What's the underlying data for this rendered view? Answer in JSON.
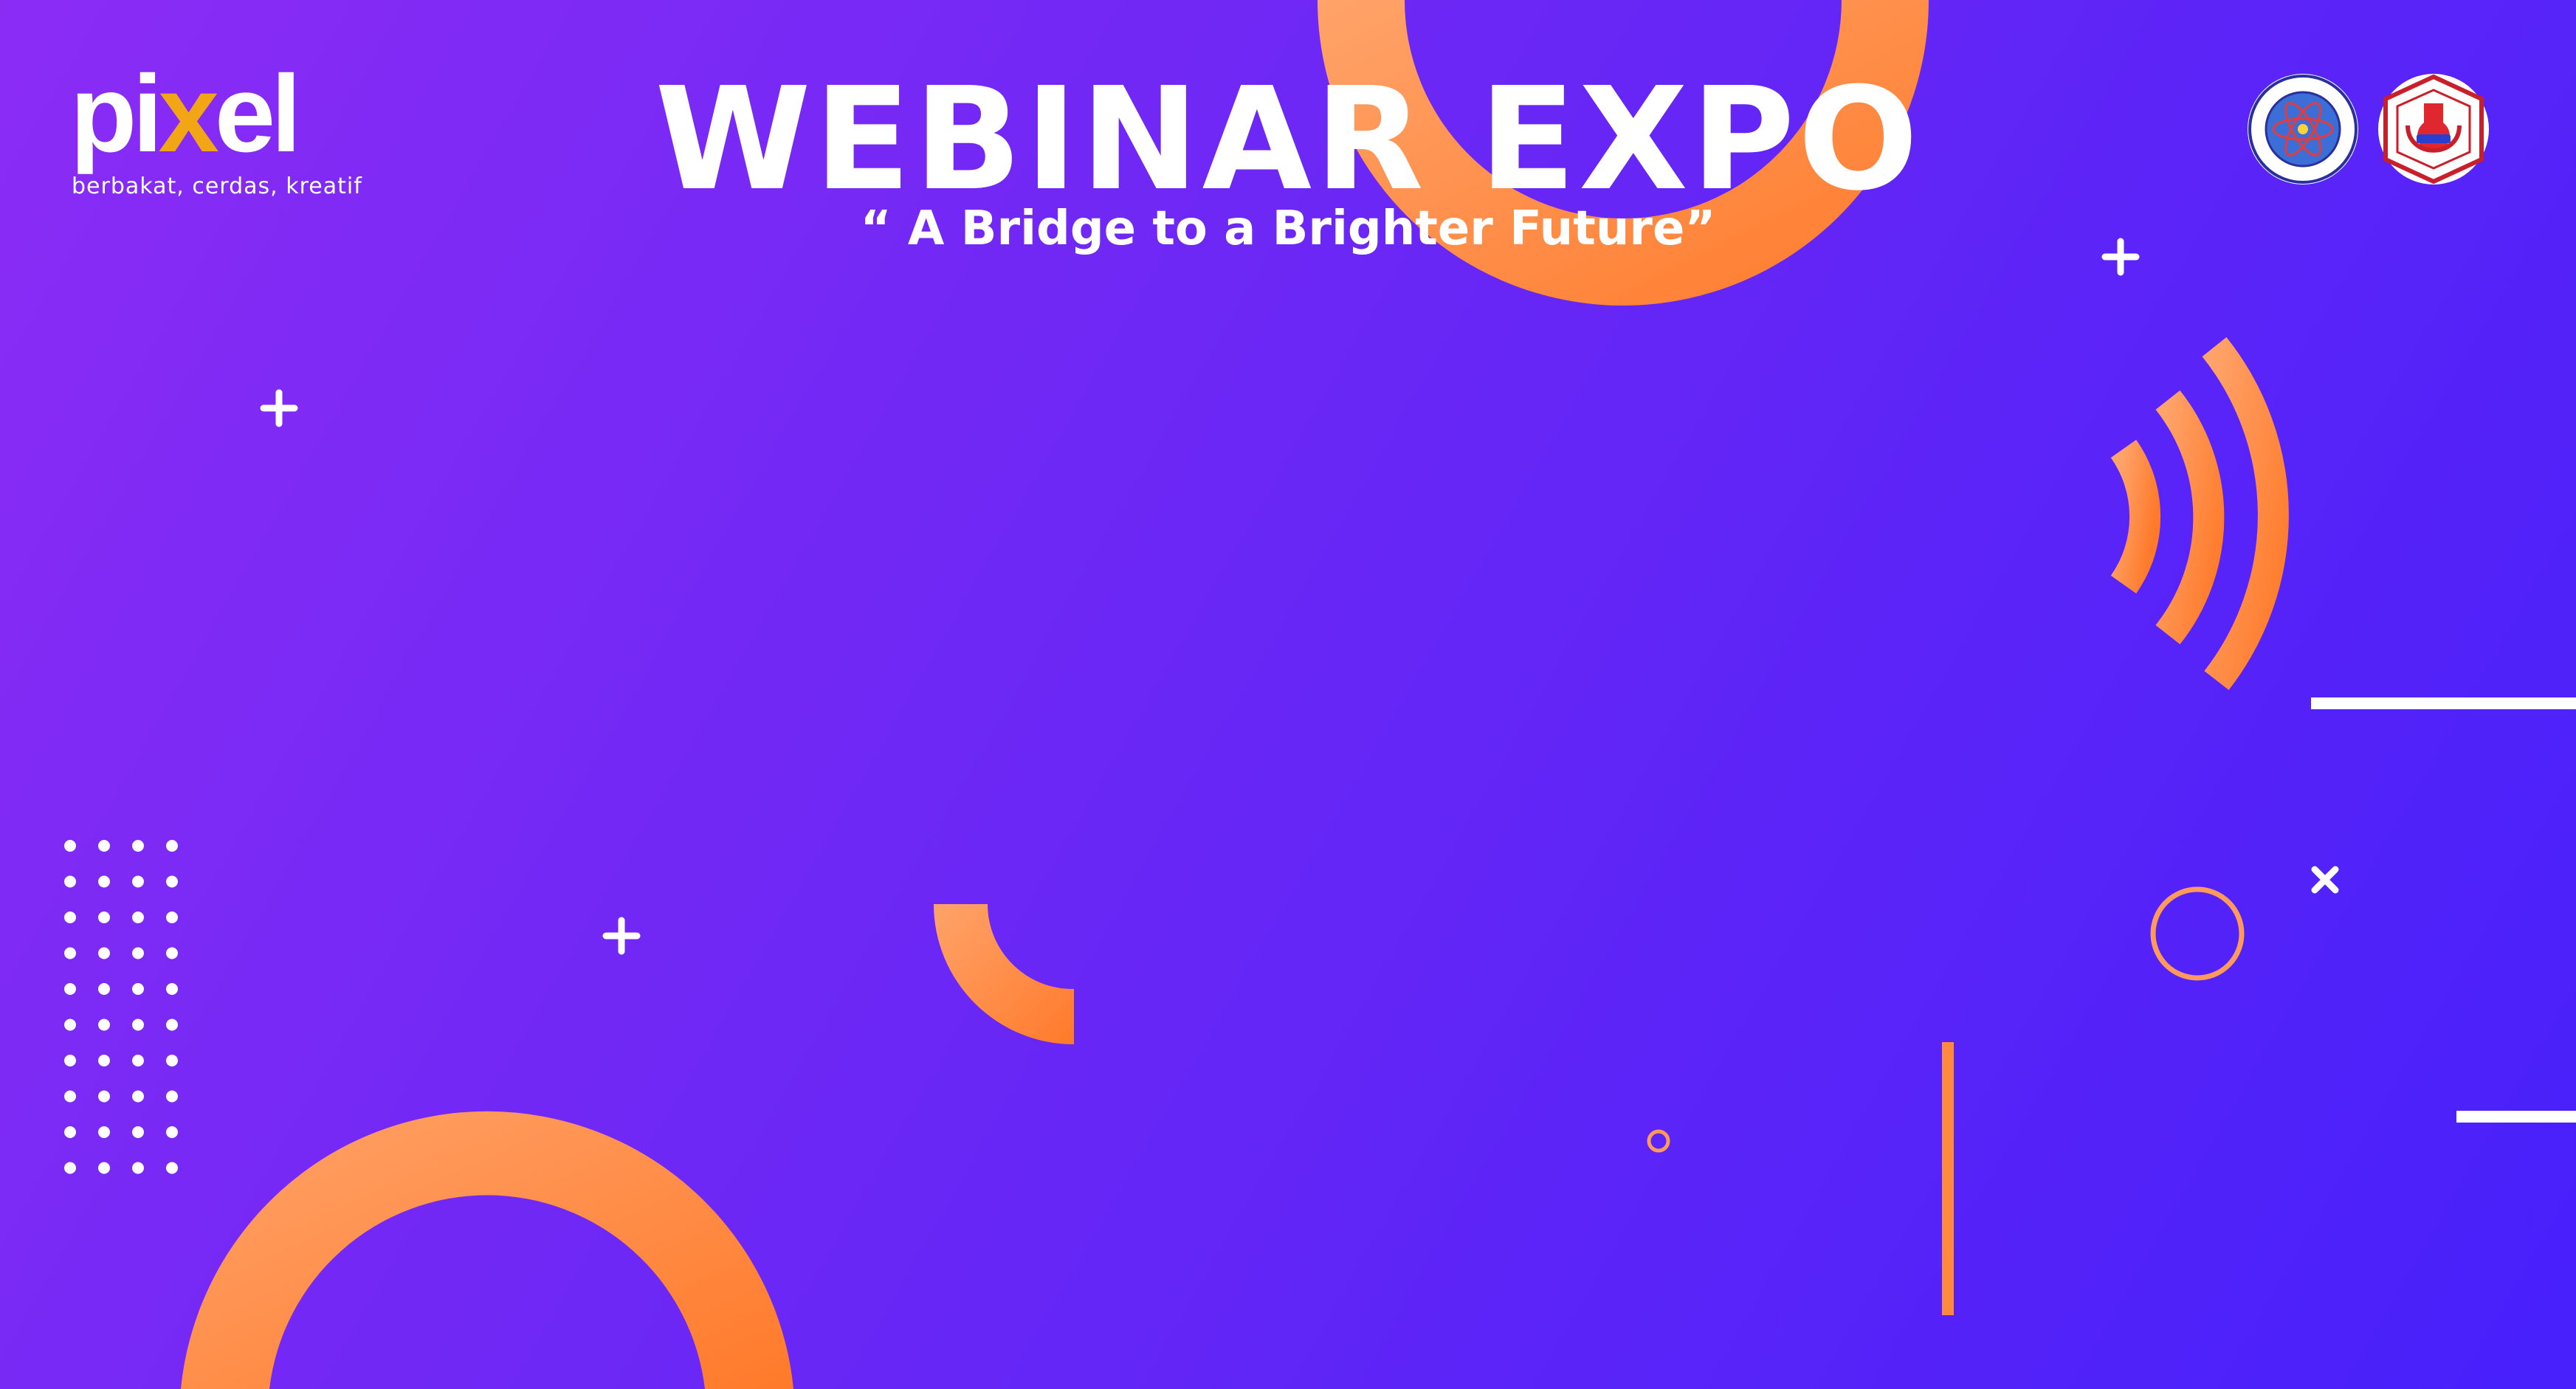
{
  "logo": {
    "word_prefix": "pi",
    "word_x": "x",
    "word_suffix": "el",
    "tagline": "berbakat, cerdas, kreatif"
  },
  "title": "WEBINAR EXPO",
  "subtitle": "“ A Bridge to a Brighter Future”",
  "seals": {
    "left": {
      "ring_text": "UNIVERSITAS TEKNOLOGI YOGYAKARTA",
      "bottom_text": "YDB IPTEK"
    },
    "right": {
      "top_text": "TEKNOLOGI",
      "side_left": "UNIVERSITAS",
      "side_right": "YOGYAKARTA",
      "center_text": "HIMATIKA",
      "bottom_left": "HIMPUNAN",
      "bottom_mid": "MAHASISWA",
      "bottom_right": "INFORMATIKA"
    }
  },
  "colors": {
    "background_start": "#8b2cf5",
    "background_end": "#4720fb",
    "accent_orange_light": "#ffa36a",
    "accent_orange_dark": "#ff7a2a",
    "logo_accent": "#f3a615",
    "white": "#ffffff"
  },
  "icons": [
    "plus-icon",
    "close-icon",
    "wifi-waves-icon",
    "dot-grid"
  ]
}
